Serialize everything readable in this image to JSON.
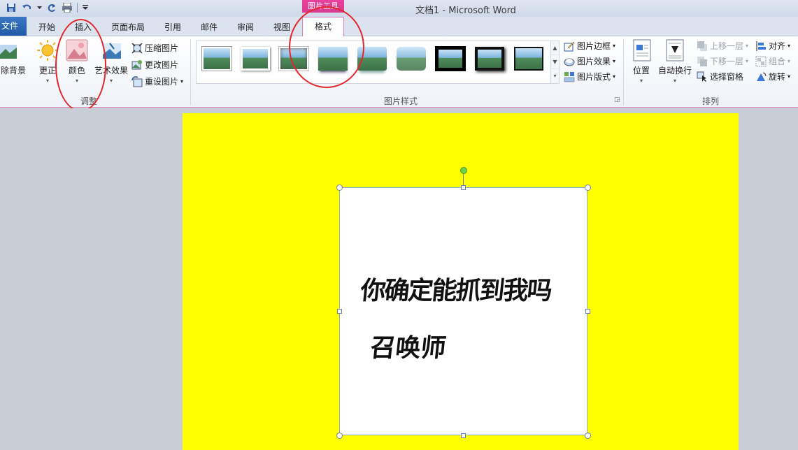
{
  "window": {
    "title": "文档1  -  Microsoft Word",
    "contextual_tab_group": "图片工具"
  },
  "quick_access": {
    "icons": [
      "save-icon",
      "undo-icon",
      "undo-dropdown-icon",
      "redo-icon",
      "print-preview-icon",
      "customize-qat-icon"
    ]
  },
  "tabs": {
    "file": "文件",
    "home": "开始",
    "insert": "插入",
    "layout": "页面布局",
    "references": "引用",
    "mailings": "邮件",
    "review": "审阅",
    "view": "视图",
    "format": "格式"
  },
  "ribbon": {
    "adjust": {
      "label": "调整",
      "remove_background": "除背景",
      "corrections": "更正",
      "color": "颜色",
      "artistic_effects": "艺术效果",
      "compress": "压缩图片",
      "change_picture": "更改图片",
      "reset_picture": "重设图片"
    },
    "picture_styles": {
      "label": "图片样式",
      "border": "图片边框",
      "effects": "图片效果",
      "layout": "图片版式",
      "style_count": 9
    },
    "arrange": {
      "label": "排列",
      "position": "位置",
      "wrap_text": "自动换行",
      "bring_forward": "上移一层",
      "send_backward": "下移一层",
      "selection_pane": "选择窗格",
      "align": "对齐",
      "group": "组合",
      "rotate": "旋转"
    }
  },
  "document": {
    "page_color": "#ffff00",
    "image_text_line1": "你确定能抓到我吗",
    "image_text_line2": "召唤师"
  },
  "colors": {
    "accent_pink": "#e0419a",
    "file_tab_blue": "#2a66b6",
    "annotation_red": "#e3262c"
  }
}
